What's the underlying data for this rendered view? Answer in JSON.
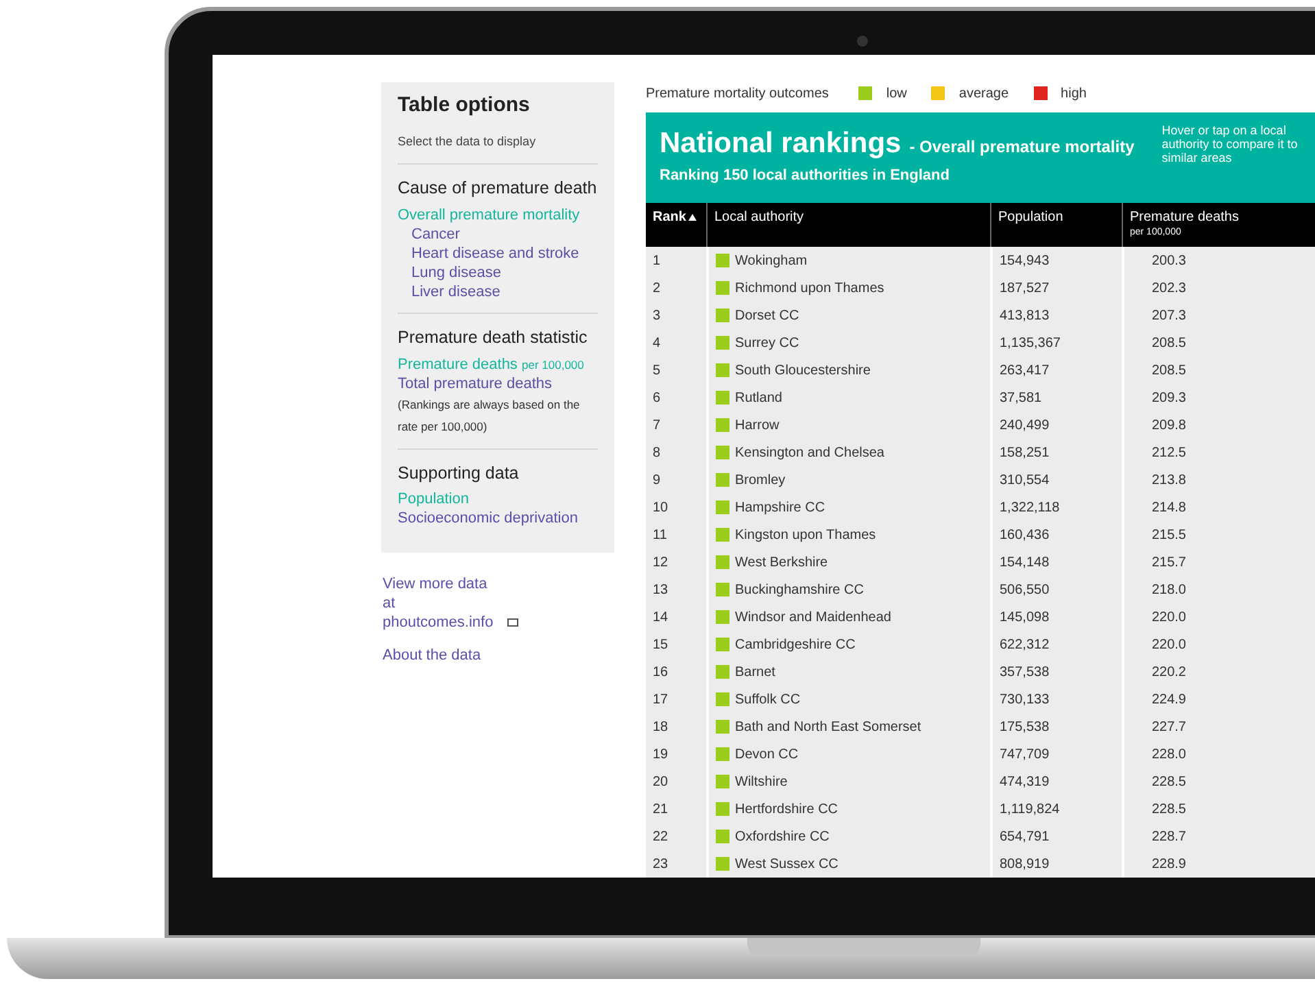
{
  "sidebar": {
    "title": "Table options",
    "hint": "Select the data to display",
    "sections": [
      {
        "heading": "Cause of premature death",
        "options": [
          {
            "label": "Overall premature mortality",
            "selected": true,
            "children": [
              {
                "label": "Cancer",
                "selected": false
              },
              {
                "label": "Heart disease and stroke",
                "selected": false
              },
              {
                "label": "Lung disease",
                "selected": false
              },
              {
                "label": "Liver disease",
                "selected": false
              }
            ]
          }
        ]
      },
      {
        "heading": "Premature death statistic",
        "options": [
          {
            "label": "Premature deaths",
            "suffix": "per 100,000",
            "selected": true
          },
          {
            "label": "Total premature deaths",
            "selected": false
          }
        ],
        "note": "(Rankings are always based on the rate per 100,000)"
      },
      {
        "heading": "Supporting data",
        "options": [
          {
            "label": "Population",
            "selected": true
          },
          {
            "label": "Socioeconomic deprivation",
            "selected": false
          }
        ]
      }
    ]
  },
  "links": [
    "View more data at phoutcomes.info",
    "About the data"
  ],
  "legend": {
    "label": "Premature mortality outcomes",
    "items": [
      {
        "label": "low",
        "color": "#9ccc1c"
      },
      {
        "label": "average",
        "color": "#f5c518"
      },
      {
        "label": "high",
        "color": "#e0241f"
      }
    ]
  },
  "banner": {
    "title": "National rankings",
    "subtitle": "- Overall premature mortality",
    "caption": "Ranking 150 local authorities in England",
    "help": "Hover or tap on a local authority to compare it to similar areas"
  },
  "table": {
    "columns": [
      {
        "label": "Rank"
      },
      {
        "label": "Local authority"
      },
      {
        "label": "Population"
      },
      {
        "label": "Premature deaths",
        "sub": "per 100,000"
      }
    ],
    "rows": [
      {
        "rank": "1",
        "name": "Wokingham",
        "population": "154,943",
        "deaths": "200.3",
        "color": "#9ccc1c"
      },
      {
        "rank": "2",
        "name": "Richmond upon Thames",
        "population": "187,527",
        "deaths": "202.3",
        "color": "#9ccc1c"
      },
      {
        "rank": "3",
        "name": "Dorset CC",
        "population": "413,813",
        "deaths": "207.3",
        "color": "#9ccc1c"
      },
      {
        "rank": "4",
        "name": "Surrey CC",
        "population": "1,135,367",
        "deaths": "208.5",
        "color": "#9ccc1c"
      },
      {
        "rank": "5",
        "name": "South Gloucestershire",
        "population": "263,417",
        "deaths": "208.5",
        "color": "#9ccc1c"
      },
      {
        "rank": "6",
        "name": "Rutland",
        "population": "37,581",
        "deaths": "209.3",
        "color": "#9ccc1c"
      },
      {
        "rank": "7",
        "name": "Harrow",
        "population": "240,499",
        "deaths": "209.8",
        "color": "#9ccc1c"
      },
      {
        "rank": "8",
        "name": "Kensington and Chelsea",
        "population": "158,251",
        "deaths": "212.5",
        "color": "#9ccc1c"
      },
      {
        "rank": "9",
        "name": "Bromley",
        "population": "310,554",
        "deaths": "213.8",
        "color": "#9ccc1c"
      },
      {
        "rank": "10",
        "name": "Hampshire CC",
        "population": "1,322,118",
        "deaths": "214.8",
        "color": "#9ccc1c"
      },
      {
        "rank": "11",
        "name": "Kingston upon Thames",
        "population": "160,436",
        "deaths": "215.5",
        "color": "#9ccc1c"
      },
      {
        "rank": "12",
        "name": "West Berkshire",
        "population": "154,148",
        "deaths": "215.7",
        "color": "#9ccc1c"
      },
      {
        "rank": "13",
        "name": "Buckinghamshire CC",
        "population": "506,550",
        "deaths": "218.0",
        "color": "#9ccc1c"
      },
      {
        "rank": "14",
        "name": "Windsor and Maidenhead",
        "population": "145,098",
        "deaths": "220.0",
        "color": "#9ccc1c"
      },
      {
        "rank": "15",
        "name": "Cambridgeshire CC",
        "population": "622,312",
        "deaths": "220.0",
        "color": "#9ccc1c"
      },
      {
        "rank": "16",
        "name": "Barnet",
        "population": "357,538",
        "deaths": "220.2",
        "color": "#9ccc1c"
      },
      {
        "rank": "17",
        "name": "Suffolk CC",
        "population": "730,133",
        "deaths": "224.9",
        "color": "#9ccc1c"
      },
      {
        "rank": "18",
        "name": "Bath and North East Somerset",
        "population": "175,538",
        "deaths": "227.7",
        "color": "#9ccc1c"
      },
      {
        "rank": "19",
        "name": "Devon CC",
        "population": "747,709",
        "deaths": "228.0",
        "color": "#9ccc1c"
      },
      {
        "rank": "20",
        "name": "Wiltshire",
        "population": "474,319",
        "deaths": "228.5",
        "color": "#9ccc1c"
      },
      {
        "rank": "21",
        "name": "Hertfordshire CC",
        "population": "1,119,824",
        "deaths": "228.5",
        "color": "#9ccc1c"
      },
      {
        "rank": "22",
        "name": "Oxfordshire CC",
        "population": "654,791",
        "deaths": "228.7",
        "color": "#9ccc1c"
      },
      {
        "rank": "23",
        "name": "West Sussex CC",
        "population": "808,919",
        "deaths": "228.9",
        "color": "#9ccc1c"
      }
    ]
  }
}
